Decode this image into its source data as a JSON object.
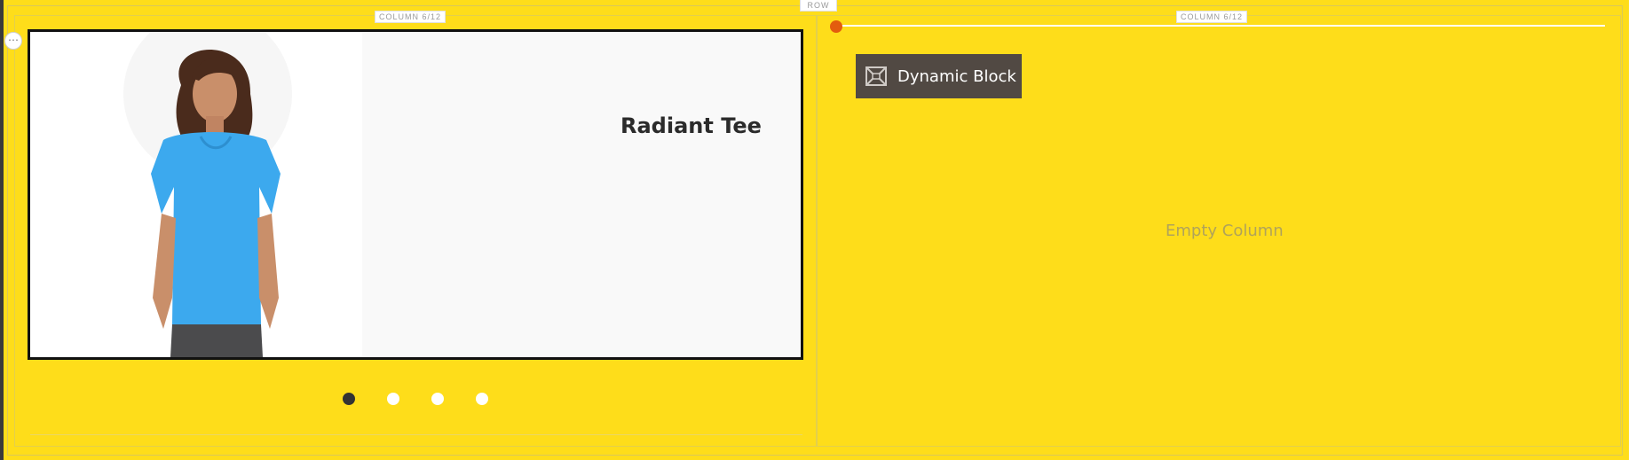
{
  "row": {
    "label": "ROW"
  },
  "columns": [
    {
      "label": "COLUMN 6/12"
    },
    {
      "label": "COLUMN 6/12"
    }
  ],
  "slider": {
    "title": "Radiant Tee",
    "image": "woman-in-blue-tee",
    "dots_total": 4,
    "active_dot": 1
  },
  "dynamic_block": {
    "label": "Dynamic Block",
    "icon": "widget-icon"
  },
  "empty_column": {
    "text": "Empty Column"
  },
  "colors": {
    "stage": "#fedd1a",
    "dynamic_block_bg": "#514943",
    "progress_knob": "#e35c0e"
  }
}
